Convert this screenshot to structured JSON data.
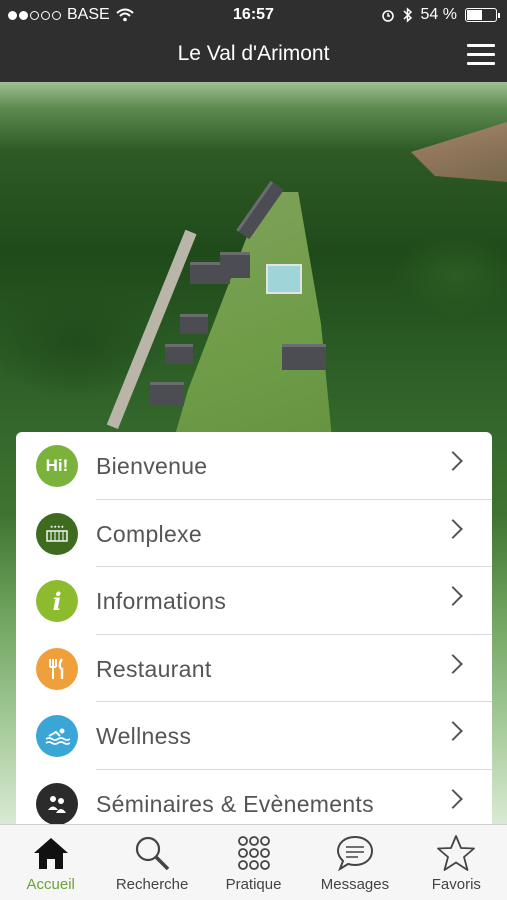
{
  "status_bar": {
    "carrier": "BASE",
    "time": "16:57",
    "battery": "54 %",
    "battery_level": 0.54
  },
  "header": {
    "title": "Le Val d'Arimont",
    "menu_icon": "hamburger-icon"
  },
  "hero": {
    "image": "aerial-valley-resort-photo"
  },
  "menu": {
    "items": [
      {
        "label": "Bienvenue",
        "icon": "hi-bubble-icon",
        "icon_text": "Hi!",
        "color": "#7ab23c"
      },
      {
        "label": "Complexe",
        "icon": "complex-building-icon",
        "color": "#3f6b1f"
      },
      {
        "label": "Informations",
        "icon": "info-icon",
        "icon_text": "i",
        "color": "#8dbb2e"
      },
      {
        "label": "Restaurant",
        "icon": "cutlery-icon",
        "color": "#f0a03a"
      },
      {
        "label": "Wellness",
        "icon": "swim-icon",
        "color": "#3aa6d6"
      },
      {
        "label": "Séminaires & Evènements",
        "icon": "meeting-icon",
        "color": "#2b2b2b"
      }
    ]
  },
  "tabbar": {
    "tabs": [
      {
        "label": "Accueil",
        "icon": "home-icon",
        "active": true
      },
      {
        "label": "Recherche",
        "icon": "search-icon",
        "active": false
      },
      {
        "label": "Pratique",
        "icon": "grid-icon",
        "active": false
      },
      {
        "label": "Messages",
        "icon": "chat-bubble-icon",
        "active": false
      },
      {
        "label": "Favoris",
        "icon": "star-icon",
        "active": false
      }
    ],
    "active_color": "#6aa237"
  }
}
